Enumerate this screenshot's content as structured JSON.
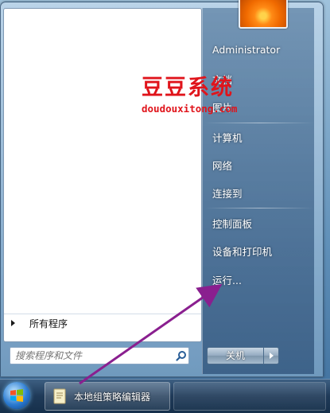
{
  "start_menu": {
    "user": {
      "name": "Administrator"
    },
    "right_items": [
      {
        "label": "文档"
      },
      {
        "label": "图片"
      },
      {
        "label": "计算机"
      },
      {
        "label": "网络"
      },
      {
        "label": "连接到"
      },
      {
        "label": "控制面板"
      },
      {
        "label": "设备和打印机"
      },
      {
        "label": "运行..."
      }
    ],
    "all_programs_label": "所有程序",
    "search": {
      "placeholder": "搜索程序和文件",
      "value": ""
    },
    "shutdown_label": "关机"
  },
  "taskbar": {
    "items": [
      {
        "label": "本地组策略编辑器"
      }
    ]
  },
  "watermark": {
    "title": "豆豆系统",
    "url": "doudouxitong.com"
  },
  "colors": {
    "watermark": "#e0141b",
    "annotation_arrow": "#8a1f8f"
  }
}
